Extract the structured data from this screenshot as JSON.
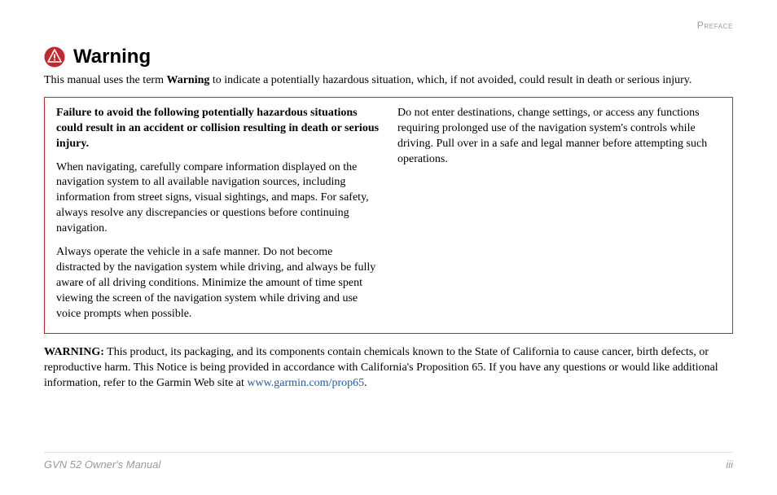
{
  "header": {
    "section": "Preface"
  },
  "title": "Warning",
  "intro": {
    "prefix": "This manual uses the term ",
    "bold": "Warning",
    "suffix": " to indicate a potentially hazardous situation, which, if not avoided, could result in death or serious injury."
  },
  "box": {
    "left": {
      "p1": "Failure to avoid the following potentially hazardous situations could result in an accident or collision resulting in death or serious injury.",
      "p2": "When navigating, carefully compare information displayed on the navigation system to all available navigation sources, including information from street signs, visual sightings, and maps. For safety, always resolve any discrepancies or questions before continuing navigation.",
      "p3": "Always operate the vehicle in a safe manner. Do not become distracted by the navigation system while driving, and always be fully aware of all driving conditions. Minimize the amount of time spent viewing the screen of the navigation system while driving and use voice prompts when possible."
    },
    "right": {
      "p1": "Do not enter destinations, change settings, or access any functions requiring prolonged use of the navigation system's controls while driving. Pull over in a safe and legal manner before attempting such operations."
    }
  },
  "postbox": {
    "label": "WARNING:",
    "text_before_link": " This product, its packaging, and its components contain chemicals known to the State of California to cause cancer, birth defects, or reproductive harm. This Notice is being provided in accordance with California's Proposition 65. If you have any questions or would like additional information, refer to the Garmin Web site at ",
    "link_text": "www.garmin.com/prop65",
    "text_after_link": "."
  },
  "footer": {
    "left": "GVN 52 Owner's Manual",
    "right": "iii"
  },
  "colors": {
    "warning_red": "#c1272d",
    "link_blue": "#1a5da8",
    "muted_gray": "#9a9a9a"
  }
}
